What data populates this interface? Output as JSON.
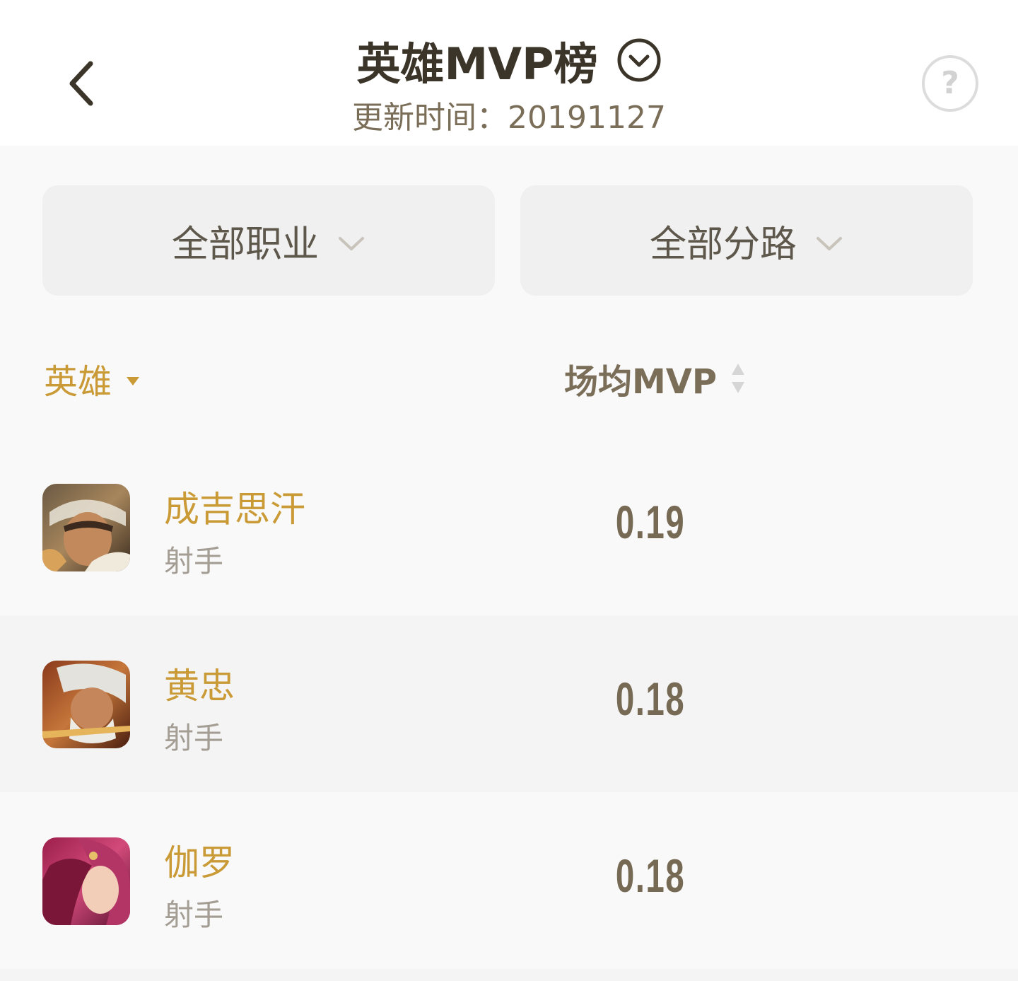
{
  "header": {
    "title": "英雄MVP榜",
    "subtitle": "更新时间：20191127",
    "back_icon": "chevron-left-icon",
    "toggle_icon": "chevron-down-circle-icon",
    "help_label": "?"
  },
  "filters": {
    "role": "全部职业",
    "lane": "全部分路"
  },
  "columns": {
    "hero": "英雄",
    "mvp": "场均MVP"
  },
  "colors": {
    "accent": "#c99a35",
    "title": "#3b3429",
    "muted": "#a39d94",
    "value": "#776a55"
  },
  "rows": [
    {
      "name": "成吉思汗",
      "role": "射手",
      "value": "0.19"
    },
    {
      "name": "黄忠",
      "role": "射手",
      "value": "0.18"
    },
    {
      "name": "伽罗",
      "role": "射手",
      "value": "0.18"
    }
  ]
}
